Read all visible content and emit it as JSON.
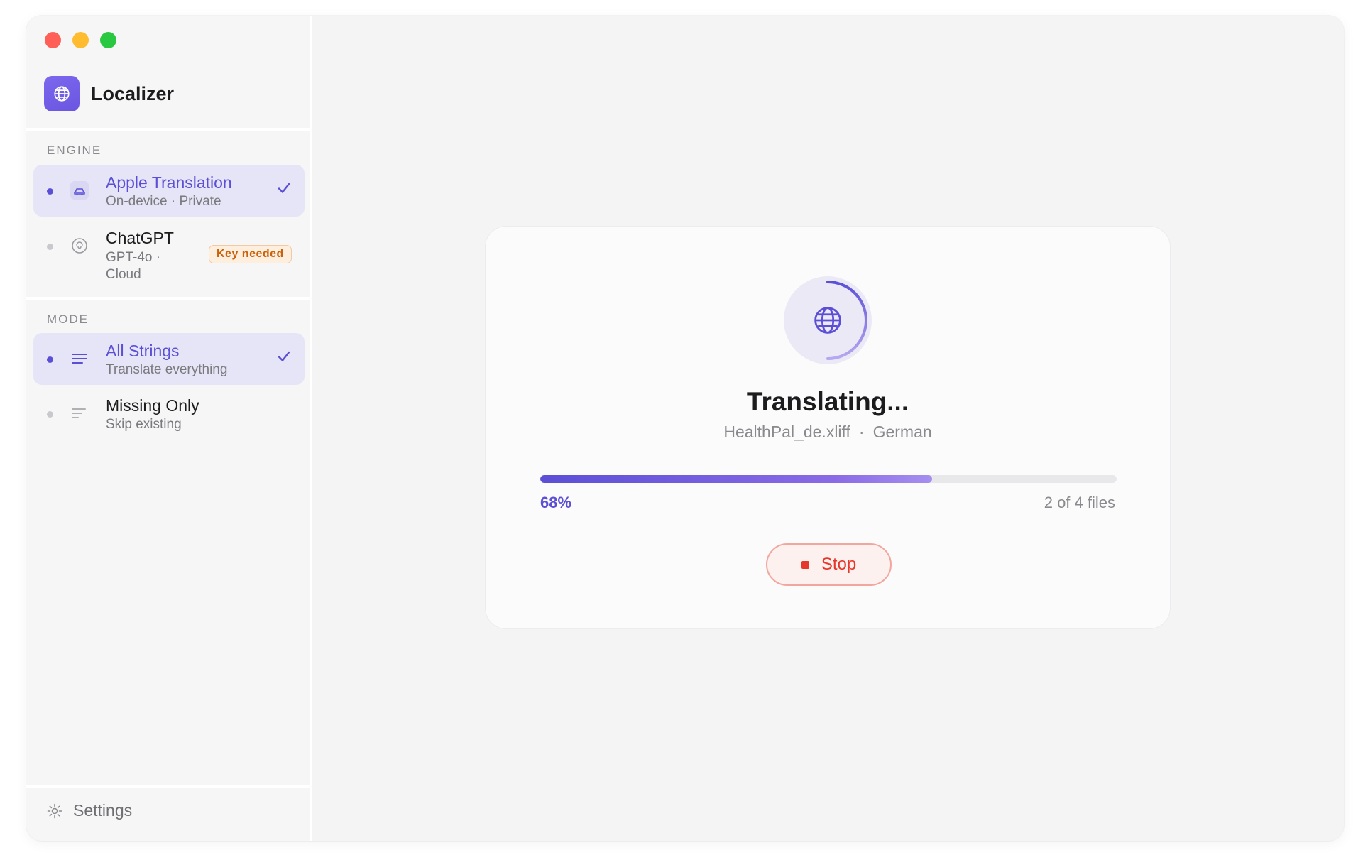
{
  "app": {
    "title": "Localizer",
    "icon": "globe-icon",
    "accent": "#5b4fd6"
  },
  "sidebar": {
    "engine_label": "ENGINE",
    "engines": [
      {
        "title": "Apple Translation",
        "subtitle": "On-device · Private",
        "selected": true,
        "icon": "car-icon"
      },
      {
        "title": "ChatGPT",
        "subtitle": "GPT-4o · Cloud",
        "selected": false,
        "icon": "openai-icon",
        "badge": "Key needed"
      }
    ],
    "mode_label": "MODE",
    "modes": [
      {
        "title": "All Strings",
        "subtitle": "Translate everything",
        "selected": true,
        "icon": "lines-icon"
      },
      {
        "title": "Missing Only",
        "subtitle": "Skip existing",
        "selected": false,
        "icon": "lines-descending-icon"
      }
    ],
    "settings_label": "Settings"
  },
  "progress": {
    "heading": "Translating...",
    "file_name": "HealthPal_de.xliff",
    "separator": "·",
    "language": "German",
    "percent": 68,
    "percent_label": "68%",
    "files_label": "2 of 4 files",
    "stop_label": "Stop"
  }
}
